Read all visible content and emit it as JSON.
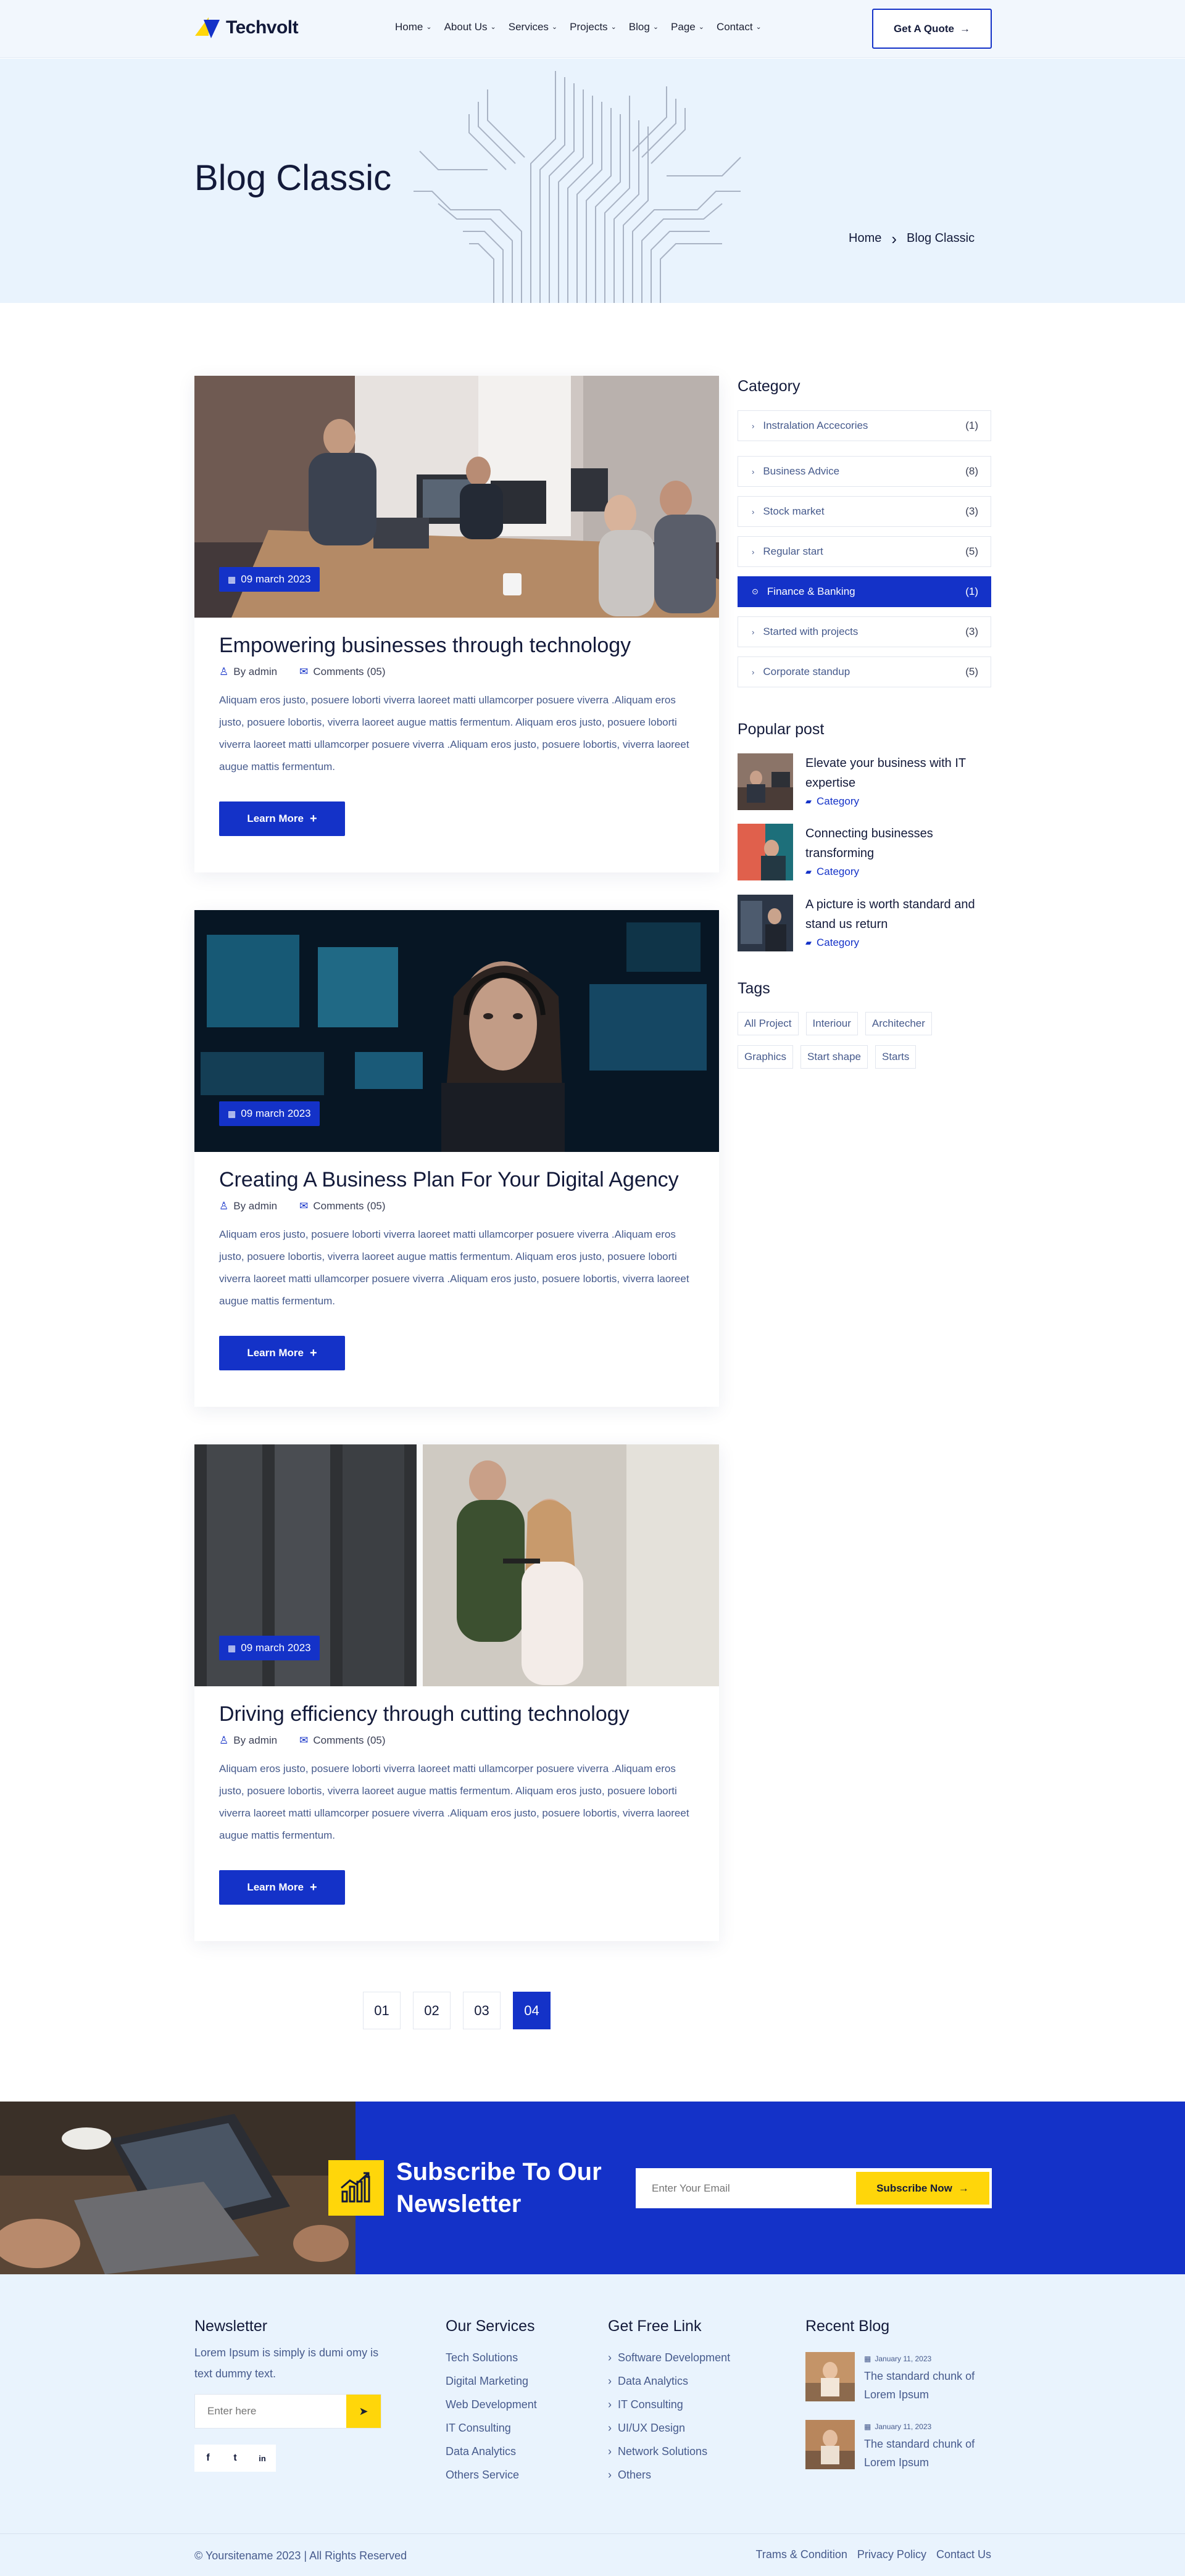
{
  "header": {
    "logo_text": "Techvolt",
    "nav": [
      {
        "label": "Home"
      },
      {
        "label": "About Us"
      },
      {
        "label": "Services"
      },
      {
        "label": "Projects"
      },
      {
        "label": "Blog"
      },
      {
        "label": "Page"
      },
      {
        "label": "Contact"
      }
    ],
    "quote_button": "Get A Quote"
  },
  "hero": {
    "title": "Blog Classic",
    "breadcrumb_home": "Home",
    "breadcrumb_sep": "›",
    "breadcrumb_current": "Blog Classic"
  },
  "posts": [
    {
      "date": "09 march 2023",
      "title": "Empowering businesses through technology",
      "author": "By admin",
      "comments": "Comments (05)",
      "excerpt": "Aliquam eros justo, posuere loborti viverra laoreet matti ullamcorper posuere viverra .Aliquam eros justo, posuere lobortis, viverra laoreet augue mattis fermentum. Aliquam eros justo, posuere loborti viverra laoreet matti ullamcorper posuere viverra .Aliquam eros justo, posuere lobortis, viverra laoreet augue mattis fermentum.",
      "button": "Learn More"
    },
    {
      "date": "09 march 2023",
      "title": "Creating A Business Plan For Your Digital Agency",
      "author": "By admin",
      "comments": "Comments (05)",
      "excerpt": "Aliquam eros justo, posuere loborti viverra laoreet matti ullamcorper posuere viverra .Aliquam eros justo, posuere lobortis, viverra laoreet augue mattis fermentum. Aliquam eros justo, posuere loborti viverra laoreet matti ullamcorper posuere viverra .Aliquam eros justo, posuere lobortis, viverra laoreet augue mattis fermentum.",
      "button": "Learn More"
    },
    {
      "date": "09 march 2023",
      "title": "Driving efficiency through cutting technology",
      "author": "By admin",
      "comments": "Comments (05)",
      "excerpt": "Aliquam eros justo, posuere loborti viverra laoreet matti ullamcorper posuere viverra .Aliquam eros justo, posuere lobortis, viverra laoreet augue mattis fermentum. Aliquam eros justo, posuere loborti viverra laoreet matti ullamcorper posuere viverra .Aliquam eros justo, posuere lobortis, viverra laoreet augue mattis fermentum.",
      "button": "Learn More"
    }
  ],
  "pagination": {
    "pages": [
      "01",
      "02",
      "03",
      "04"
    ],
    "active": "04"
  },
  "sidebar": {
    "category_heading": "Category",
    "categories": [
      {
        "label": "Instralation Accecories",
        "count": "(1)"
      },
      {
        "label": "Business Advice",
        "count": "(8)"
      },
      {
        "label": "Stock market",
        "count": "(3)"
      },
      {
        "label": "Regular start",
        "count": "(5)"
      },
      {
        "label": "Finance & Banking",
        "count": "(1)",
        "active": true
      },
      {
        "label": "Started with projects",
        "count": "(3)"
      },
      {
        "label": "Corporate standup",
        "count": "(5)"
      }
    ],
    "popular_heading": "Popular post",
    "popular": [
      {
        "title": "Elevate your business with IT expertise",
        "category": "Category"
      },
      {
        "title": "Connecting businesses transforming",
        "category": "Category"
      },
      {
        "title": "A picture is worth standard and stand us return",
        "category": "Category"
      }
    ],
    "tags_heading": "Tags",
    "tags": [
      "All Project",
      "Interiour",
      "Architecher",
      "Graphics",
      "Start shape",
      "Starts"
    ]
  },
  "subscribe": {
    "title": "Subscribe To Our Newsletter",
    "placeholder": "Enter Your Email",
    "button": "Subscribe Now",
    "icon": "growth-chart-icon"
  },
  "footer": {
    "newsletter_heading": "Newsletter",
    "newsletter_text": "Lorem Ipsum is simply is dumi omy is text  dummy text.",
    "newsletter_placeholder": "Enter here",
    "social_icons": [
      "f",
      "t",
      "in"
    ],
    "services_heading": "Our Services",
    "services": [
      "Tech Solutions",
      "Digital Marketing",
      "Web Development",
      "IT Consulting",
      "Data Analytics",
      "Others Service"
    ],
    "links_heading": "Get Free Link",
    "links": [
      "Software Development",
      "Data Analytics",
      "IT Consulting",
      "UI/UX Design",
      "Network Solutions",
      "Others"
    ],
    "recent_heading": "Recent Blog",
    "recent": [
      {
        "date": "January 11, 2023",
        "title": "The standard chunk of Lorem Ipsum"
      },
      {
        "date": "January 11, 2023",
        "title": "The standard chunk of Lorem Ipsum"
      }
    ],
    "copyright": "© Yoursitename  2023 | All Rights Reserved",
    "bottom_links": [
      "Trams & Condition",
      "Privacy Policy",
      "Contact Us"
    ]
  },
  "colors": {
    "primary": "#1432c8",
    "accent": "#ffd60a",
    "hero_bg": "#e9f3fd",
    "text": "#465a8c"
  }
}
